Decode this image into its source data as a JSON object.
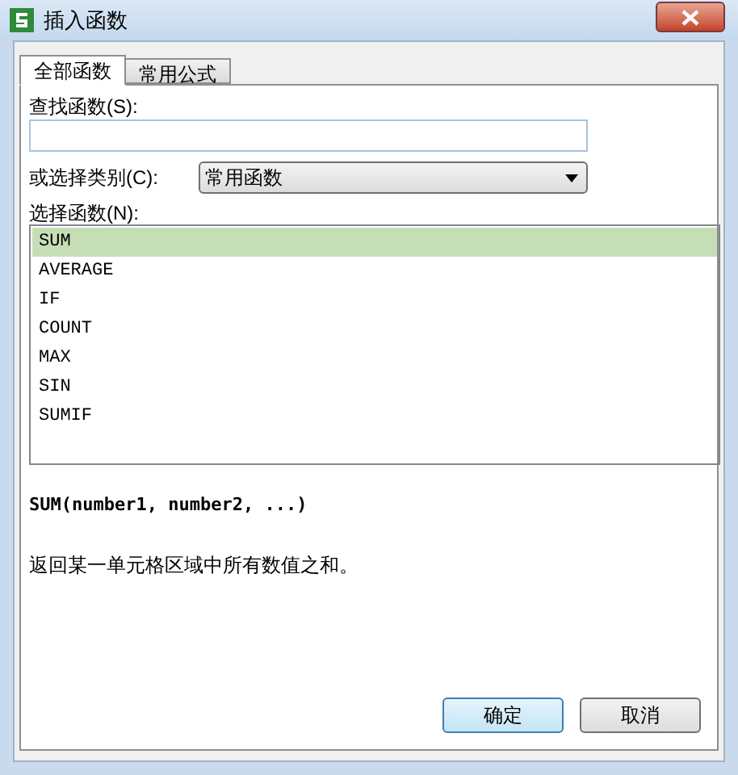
{
  "window": {
    "title": "插入函数"
  },
  "tabs": [
    {
      "label": "全部函数",
      "selected": true
    },
    {
      "label": "常用公式",
      "selected": false
    }
  ],
  "search": {
    "label": "查找函数(S):"
  },
  "category": {
    "label": "或选择类别(C):",
    "value": "常用函数"
  },
  "function_list": {
    "label": "选择函数(N):",
    "items": [
      {
        "label": "SUM",
        "selected": true
      },
      {
        "label": "AVERAGE",
        "selected": false
      },
      {
        "label": "IF",
        "selected": false
      },
      {
        "label": "COUNT",
        "selected": false
      },
      {
        "label": "MAX",
        "selected": false
      },
      {
        "label": "SIN",
        "selected": false
      },
      {
        "label": "SUMIF",
        "selected": false
      }
    ]
  },
  "signature": "SUM(number1, number2, ...)",
  "description": "返回某一单元格区域中所有数值之和。",
  "buttons": [
    {
      "label": "确定",
      "kind": "default"
    },
    {
      "label": "取消",
      "kind": "normal"
    }
  ]
}
